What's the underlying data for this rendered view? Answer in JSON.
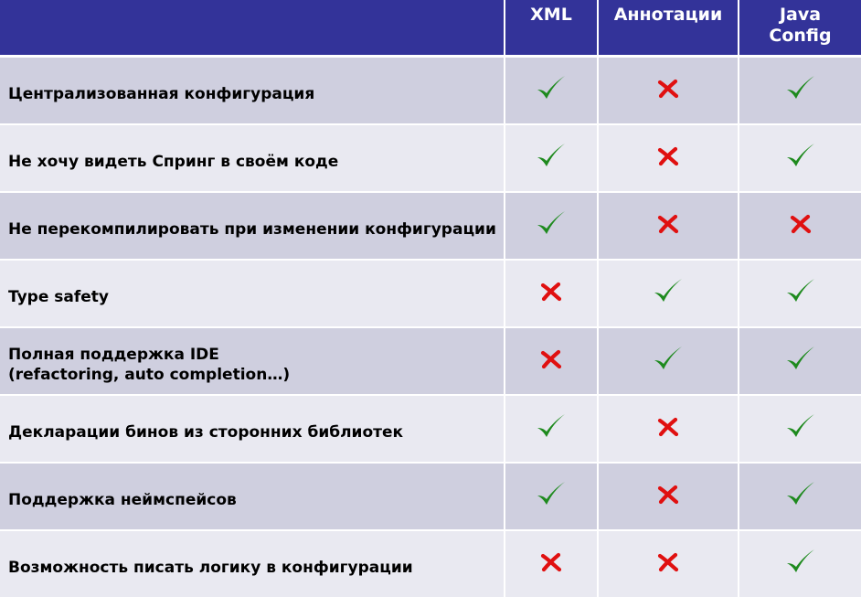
{
  "header": {
    "feature_column": "",
    "columns": [
      "XML",
      "Аннотации",
      "Java\nConfig"
    ]
  },
  "rows": [
    {
      "feature": "Централизованная конфигурация",
      "values": [
        "yes",
        "no",
        "yes"
      ]
    },
    {
      "feature": "Не хочу видеть Спринг в своём коде",
      "values": [
        "yes",
        "no",
        "yes"
      ]
    },
    {
      "feature": "Не перекомпилировать при изменении конфигурации",
      "values": [
        "yes",
        "no",
        "no"
      ]
    },
    {
      "feature": "Type safety",
      "values": [
        "no",
        "yes",
        "yes"
      ]
    },
    {
      "feature": "Полная поддержка IDE\n(refactoring, auto completion…)",
      "values": [
        "no",
        "yes",
        "yes"
      ]
    },
    {
      "feature": "Декларации бинов из сторонних библиотек",
      "values": [
        "yes",
        "no",
        "yes"
      ]
    },
    {
      "feature": "Поддержка неймспейсов",
      "values": [
        "yes",
        "no",
        "yes"
      ]
    },
    {
      "feature": "Возможность писать логику в конфигурации",
      "values": [
        "no",
        "no",
        "yes"
      ]
    }
  ],
  "icons": {
    "yes": "check-icon",
    "no": "cross-icon"
  },
  "colors": {
    "header_bg": "#333399",
    "header_text": "#ffffff",
    "row_odd": "#cfcfdf",
    "row_even": "#e9e9f1",
    "check": "#1e8a1e",
    "cross": "#e01010"
  }
}
